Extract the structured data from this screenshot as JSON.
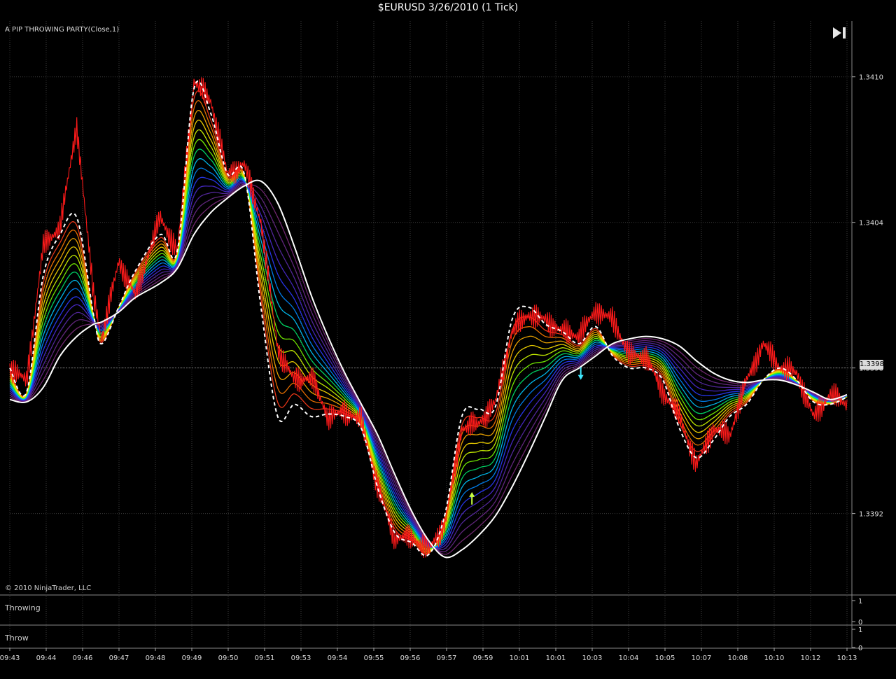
{
  "window": {
    "title": "$EURUSD  3/26/2010 (1 Tick)"
  },
  "indicator_label": "A PIP THROWING PARTY(Close,1)",
  "copyright": "© 2010 NinjaTrader, LLC",
  "price_marker": "1.3398",
  "panels": {
    "throwing": {
      "label": "Throwing",
      "ticks": [
        "1",
        "0"
      ]
    },
    "throw": {
      "label": "Throw",
      "ticks": [
        "1",
        "0"
      ]
    }
  },
  "colors": {
    "background": "#000000",
    "price": "#ff1a1a",
    "dashed_line": "#ffffff",
    "slow_line": "#ffffff",
    "rainbow": [
      "#ff3b1a",
      "#ff7a00",
      "#ffb000",
      "#ffe000",
      "#d4ff00",
      "#7cff00",
      "#00e36b",
      "#00c8ff",
      "#0088ff",
      "#2a3bff",
      "#4a2ad0",
      "#5a2aa8",
      "#6a2a8a",
      "#7a2a7a"
    ],
    "buy_arrow": "#c8ff40",
    "sell_arrow": "#40e8ff",
    "grid": "#3a3a3a"
  },
  "chart_data": {
    "type": "line",
    "title": "$EURUSD  3/26/2010 (1 Tick)",
    "xlabel": "",
    "ylabel": "",
    "ylim": [
      1.33887,
      1.34123
    ],
    "y_ticks": [
      "1.3410",
      "1.3404",
      "1.3398",
      "1.3392"
    ],
    "y_tick_values": [
      1.341,
      1.3404,
      1.3398,
      1.3392
    ],
    "x_ticks": [
      "09:43",
      "09:44",
      "09:46",
      "09:47",
      "09:48",
      "09:49",
      "09:50",
      "09:51",
      "09:53",
      "09:54",
      "09:55",
      "09:56",
      "09:57",
      "09:59",
      "10:01",
      "10:01",
      "10:03",
      "10:04",
      "10:05",
      "10:07",
      "10:08",
      "10:10",
      "10:12",
      "10:13"
    ],
    "grid": true,
    "x_range": [
      0,
      100
    ],
    "series": [
      {
        "role": "price",
        "x": [
          0,
          2,
          4,
          6,
          8,
          10,
          11,
          13,
          15,
          18,
          20,
          22,
          24,
          26,
          28,
          30,
          32,
          34,
          36,
          38,
          40,
          42,
          44,
          46,
          48,
          50,
          52,
          54,
          56,
          58,
          60,
          62,
          64,
          66,
          68,
          70,
          72,
          74,
          76,
          78,
          80,
          82,
          84,
          86,
          88,
          90,
          92,
          94,
          96,
          98,
          100
        ],
        "values": [
          1.3398,
          1.33975,
          1.3403,
          1.34038,
          1.3408,
          1.3401,
          1.33992,
          1.34024,
          1.3401,
          1.34042,
          1.34028,
          1.34098,
          1.3409,
          1.3406,
          1.34064,
          1.3404,
          1.33988,
          1.33975,
          1.33976,
          1.3396,
          1.33962,
          1.33958,
          1.3393,
          1.3391,
          1.3391,
          1.33905,
          1.33916,
          1.33955,
          1.33957,
          1.33966,
          1.33995,
          1.34002,
          1.34,
          1.33995,
          1.33993,
          1.34004,
          1.34,
          1.33985,
          1.33985,
          1.3397,
          1.3396,
          1.3394,
          1.33955,
          1.33952,
          1.33975,
          1.3399,
          1.3398,
          1.33978,
          1.3396,
          1.33969,
          1.33965
        ]
      },
      {
        "role": "fast-dashed",
        "x": [
          0,
          2,
          4,
          6,
          8,
          10,
          11,
          13,
          15,
          18,
          20,
          22,
          24,
          26,
          28,
          30,
          32,
          34,
          36,
          38,
          40,
          42,
          44,
          46,
          48,
          50,
          52,
          54,
          56,
          58,
          60,
          62,
          64,
          66,
          68,
          70,
          72,
          74,
          76,
          78,
          80,
          82,
          84,
          86,
          88,
          90,
          92,
          94,
          96,
          98,
          100
        ],
        "values": [
          1.3398,
          1.3397,
          1.34018,
          1.34035,
          1.34042,
          1.34002,
          1.3399,
          1.34005,
          1.3402,
          1.34035,
          1.34028,
          1.34095,
          1.34085,
          1.3406,
          1.3406,
          1.34005,
          1.3396,
          1.33965,
          1.3396,
          1.33961,
          1.3396,
          1.33955,
          1.3393,
          1.33912,
          1.33908,
          1.33903,
          1.3392,
          1.3396,
          1.33963,
          1.33964,
          1.34,
          1.34005,
          1.33998,
          1.33995,
          1.3399,
          1.33997,
          1.33985,
          1.3398,
          1.3398,
          1.33975,
          1.33955,
          1.33943,
          1.3395,
          1.3396,
          1.33965,
          1.33975,
          1.3398,
          1.33975,
          1.33966,
          1.33965,
          1.33968
        ]
      },
      {
        "role": "slow-solid",
        "x": [
          0,
          2,
          4,
          6,
          8,
          10,
          11,
          13,
          15,
          18,
          20,
          22,
          24,
          26,
          28,
          30,
          32,
          34,
          36,
          38,
          40,
          42,
          44,
          46,
          48,
          50,
          52,
          54,
          56,
          58,
          60,
          62,
          64,
          66,
          68,
          70,
          72,
          74,
          76,
          78,
          80,
          82,
          84,
          86,
          88,
          90,
          92,
          94,
          96,
          98,
          100
        ],
        "values": [
          1.33967,
          1.33966,
          1.33972,
          1.33985,
          1.33993,
          1.33998,
          1.33999,
          1.34003,
          1.34009,
          1.34015,
          1.34021,
          1.34035,
          1.34044,
          1.3405,
          1.34055,
          1.34057,
          1.34048,
          1.3403,
          1.3401,
          1.33993,
          1.33978,
          1.33965,
          1.33952,
          1.33936,
          1.33921,
          1.33909,
          1.33902,
          1.33905,
          1.33911,
          1.33919,
          1.33931,
          1.33945,
          1.3396,
          1.33975,
          1.3398,
          1.33985,
          1.3399,
          1.33992,
          1.33993,
          1.33992,
          1.33989,
          1.33983,
          1.33978,
          1.33975,
          1.33974,
          1.33975,
          1.33975,
          1.33973,
          1.3397,
          1.33967,
          1.33969
        ]
      }
    ],
    "ribbon_lines": 14,
    "signals": [
      {
        "type": "buy-arrow",
        "x": 55.2,
        "y": 1.33926
      },
      {
        "type": "sell-arrow",
        "x": 68.2,
        "y": 1.33978
      }
    ]
  }
}
